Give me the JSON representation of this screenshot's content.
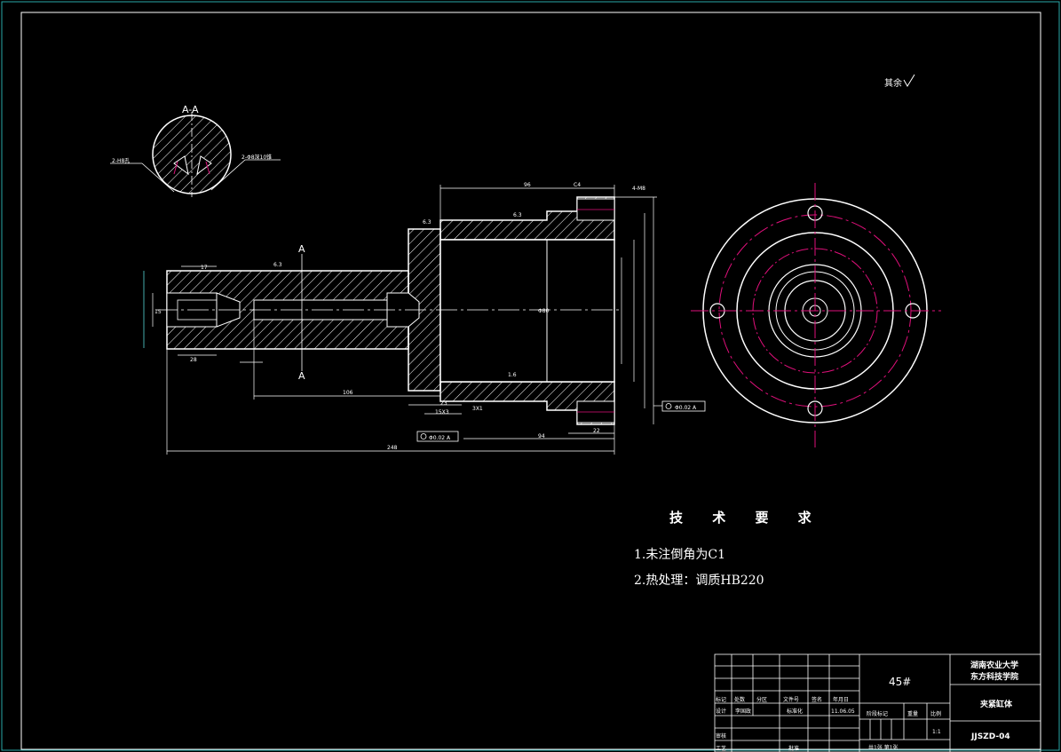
{
  "section": {
    "label": "A-A",
    "left_callout": "2-H8孔",
    "right_callout": "2-Φ8深10锥"
  },
  "roughness_note": "其余",
  "cut_marks": [
    "A",
    "A"
  ],
  "dimensions": {
    "d_96": "96",
    "c4": "C4",
    "thread": "4-M8",
    "r63_a": "6.3",
    "r63_b": "6.3",
    "r63_c": "6.3",
    "d_17": "17",
    "d_106": "106",
    "d_23": "23",
    "d_chamfer": "3X1",
    "d_groove": "15X3",
    "d_94": "94",
    "d_22": "22",
    "d_248": "248",
    "d_28": "28",
    "d_15": "15",
    "d_bore": "Φ80",
    "tol_left": "Φ0.02 A",
    "tol_right": "Φ0.02 A",
    "datum": "A",
    "r16": "1.6"
  },
  "requirements": {
    "title": "技 术 要 求",
    "items": [
      "1.未注倒角为C1",
      "2.热处理：调质HB220"
    ]
  },
  "title_block": {
    "material": "45#",
    "school_1": "湖南农业大学",
    "school_2": "东方科技学院",
    "part_name": "夹紧缸体",
    "drawing_no": "JJSZD-04",
    "scale_value": "1:1",
    "headers": [
      "标记",
      "处数",
      "分区",
      "文件号",
      "签名",
      "年月日"
    ],
    "row_design": [
      "设计",
      "李国政",
      "",
      "标准化",
      "",
      "11.06.05"
    ],
    "stage_label": "阶段标记",
    "weight_label": "重量",
    "ratio_label": "比例",
    "check_label": "审核",
    "process_label": "工艺",
    "approve_label": "批准",
    "sheet_info": "共1张  第1张"
  }
}
